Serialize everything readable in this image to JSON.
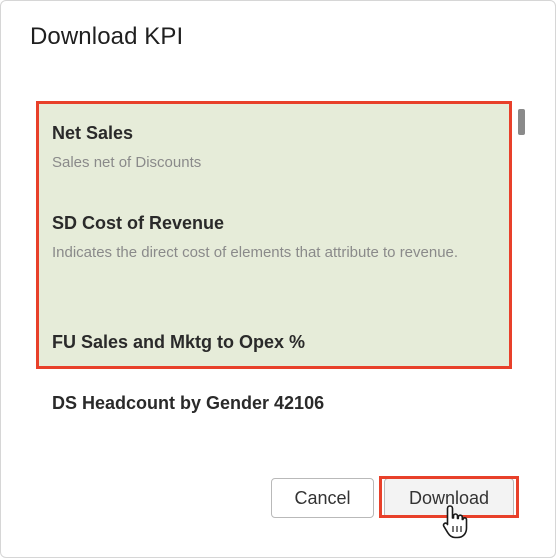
{
  "dialog": {
    "title": "Download KPI"
  },
  "kpis": [
    {
      "name": "Net Sales",
      "description": "Sales net of Discounts"
    },
    {
      "name": "SD Cost of Revenue",
      "description": "Indicates the direct cost of elements that attribute to revenue."
    },
    {
      "name": "FU Sales and Mktg to Opex %",
      "description": ""
    },
    {
      "name": "DS Headcount by Gender 42106",
      "description": ""
    }
  ],
  "buttons": {
    "cancel_label": "Cancel",
    "download_label": "Download"
  },
  "colors": {
    "highlight_border": "#e8402a",
    "highlight_fill": "#e6ecd9"
  },
  "icons": {
    "cursor": "hand-pointer-icon"
  }
}
